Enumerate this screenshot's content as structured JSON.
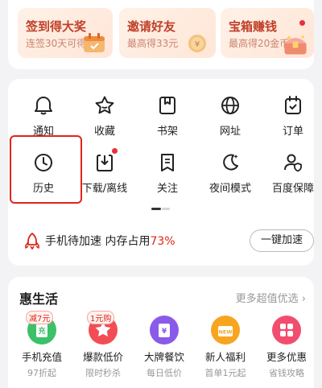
{
  "promos": [
    {
      "title": "签到得大奖",
      "subtitle": "连签30天可得",
      "icon": "calendar-gift-icon"
    },
    {
      "title": "邀请好友",
      "subtitle": "最高得33元",
      "icon": "coin-icon"
    },
    {
      "title": "宝箱赚钱",
      "subtitle": "最高得20金币",
      "icon": "treasure-chest-icon",
      "has_dot": true
    }
  ],
  "tools": [
    {
      "label": "通知",
      "icon": "bell-icon"
    },
    {
      "label": "收藏",
      "icon": "star-icon"
    },
    {
      "label": "书架",
      "icon": "bookshelf-icon"
    },
    {
      "label": "网址",
      "icon": "globe-icon"
    },
    {
      "label": "订单",
      "icon": "order-icon"
    },
    {
      "label": "历史",
      "icon": "clock-icon"
    },
    {
      "label": "下载/离线",
      "icon": "download-icon",
      "has_dot": true
    },
    {
      "label": "关注",
      "icon": "bookmark-icon"
    },
    {
      "label": "夜间模式",
      "icon": "moon-icon"
    },
    {
      "label": "百度保障",
      "icon": "shield-user-icon"
    }
  ],
  "speed": {
    "text": "手机待加速 内存占用",
    "percent": "73%",
    "button": "一键加速",
    "icon": "rocket-icon"
  },
  "life": {
    "title": "惠生活",
    "more": "更多超值优选 ›",
    "services": [
      {
        "name": "手机充值",
        "sub": "97折起",
        "tag": "减7元",
        "icon": "recharge-icon",
        "color": "#3cc06a"
      },
      {
        "name": "爆款低价",
        "sub": "限时秒杀",
        "tag": "1元购",
        "icon": "star-deal-icon",
        "color": "#f24d55"
      },
      {
        "name": "大牌餐饮",
        "sub": "每日低价",
        "tag": "",
        "icon": "coupon-icon",
        "color": "#8a5ae8"
      },
      {
        "name": "新人福利",
        "sub": "首单1元起",
        "tag": "",
        "icon": "new-gift-icon",
        "color": "#f7a51f"
      },
      {
        "name": "更多优惠",
        "sub": "省钱攻略",
        "tag": "",
        "icon": "grid-icon",
        "color": "#f24d6e"
      }
    ]
  },
  "colors": {
    "accent_red": "#e0241b",
    "highlight_border": "#e0241b"
  }
}
